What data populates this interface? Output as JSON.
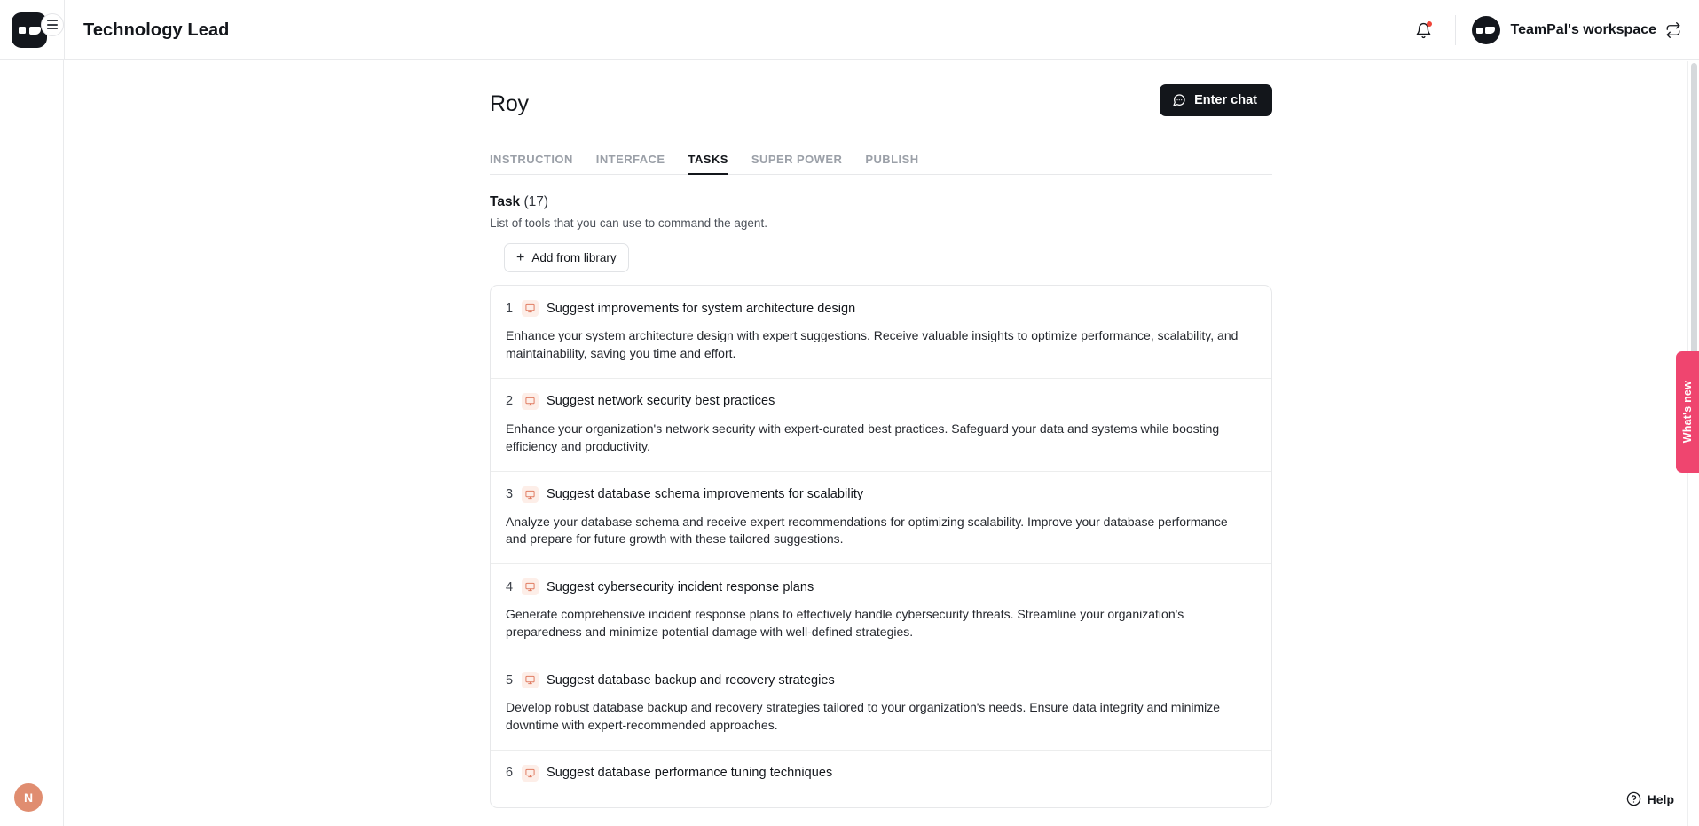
{
  "topbar": {
    "logo_icon": "teampal-logo-icon",
    "menu_icon": "hamburger-menu-icon",
    "title": "Technology Lead",
    "notification_icon": "bell-icon",
    "workspace_name": "TeamPal's workspace",
    "workspace_switch_icon": "switch-workspace-icon"
  },
  "rail": {
    "user_initial": "N"
  },
  "page": {
    "title": "Roy",
    "enter_chat_label": "Enter chat",
    "chat_icon": "chat-bubble-icon"
  },
  "tabs": [
    {
      "label": "INSTRUCTION",
      "active": false
    },
    {
      "label": "INTERFACE",
      "active": false
    },
    {
      "label": "TASKS",
      "active": true
    },
    {
      "label": "SUPER POWER",
      "active": false
    },
    {
      "label": "PUBLISH",
      "active": false
    }
  ],
  "section": {
    "title_label": "Task",
    "count_label": "(17)",
    "subtitle": "List of tools that you can use to command the agent.",
    "add_button_label": "Add from library",
    "add_icon": "plus-icon"
  },
  "tasks": [
    {
      "num": "1",
      "icon": "task-monitor-icon",
      "name": "Suggest improvements for system architecture design",
      "desc": "Enhance your system architecture design with expert suggestions. Receive valuable insights to optimize performance, scalability, and maintainability, saving you time and effort."
    },
    {
      "num": "2",
      "icon": "task-monitor-icon",
      "name": "Suggest network security best practices",
      "desc": "Enhance your organization's network security with expert-curated best practices. Safeguard your data and systems while boosting efficiency and productivity."
    },
    {
      "num": "3",
      "icon": "task-monitor-icon",
      "name": "Suggest database schema improvements for scalability",
      "desc": "Analyze your database schema and receive expert recommendations for optimizing scalability. Improve your database performance and prepare for future growth with these tailored suggestions."
    },
    {
      "num": "4",
      "icon": "task-monitor-icon",
      "name": "Suggest cybersecurity incident response plans",
      "desc": "Generate comprehensive incident response plans to effectively handle cybersecurity threats. Streamline your organization's preparedness and minimize potential damage with well-defined strategies."
    },
    {
      "num": "5",
      "icon": "task-monitor-icon",
      "name": "Suggest database backup and recovery strategies",
      "desc": "Develop robust database backup and recovery strategies tailored to your organization's needs. Ensure data integrity and minimize downtime with expert-recommended approaches."
    },
    {
      "num": "6",
      "icon": "task-monitor-icon",
      "name": "Suggest database performance tuning techniques",
      "desc": ""
    }
  ],
  "whats_new": {
    "label": "What's new"
  },
  "help": {
    "label": "Help",
    "icon": "question-circle-icon"
  },
  "colors": {
    "accent_dark": "#13161b",
    "whats_new_pink": "#ef456f",
    "avatar_coral": "#e08d70",
    "task_icon_bg": "#fdeee8",
    "notification_red": "#f04438"
  }
}
